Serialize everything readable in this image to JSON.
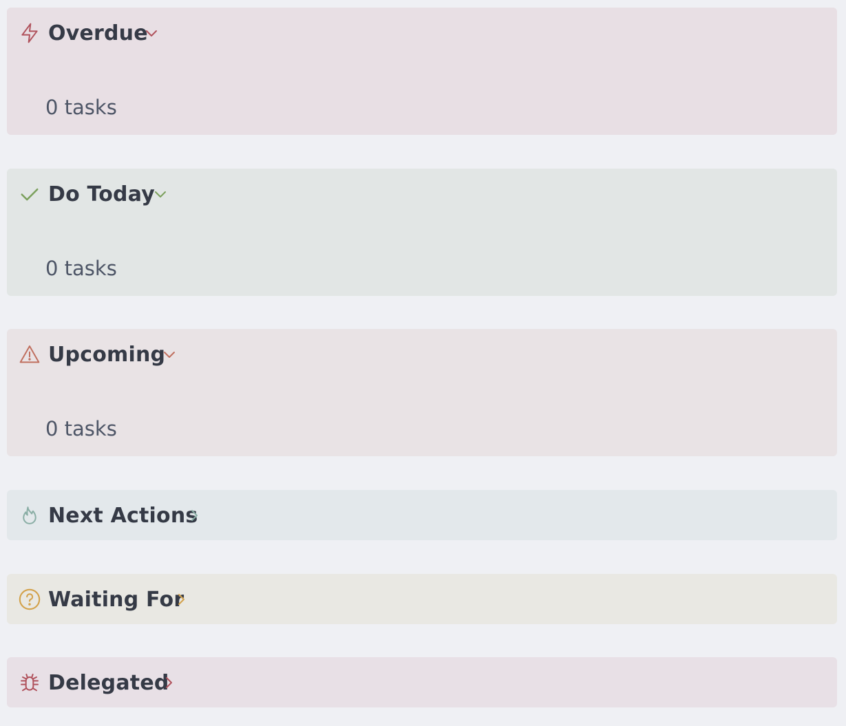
{
  "sections": [
    {
      "title": "Overdue",
      "icon": "lightning-icon",
      "expanded": true,
      "count_text": "0 tasks",
      "bg_color": "#e8dfe4",
      "accent_color": "#b0525c"
    },
    {
      "title": "Do Today",
      "icon": "check-icon",
      "expanded": true,
      "count_text": "0 tasks",
      "bg_color": "#e2e6e5",
      "accent_color": "#7ba05c"
    },
    {
      "title": "Upcoming",
      "icon": "warning-triangle-icon",
      "expanded": true,
      "count_text": "0 tasks",
      "bg_color": "#e9e3e5",
      "accent_color": "#c06f5f"
    },
    {
      "title": "Next Actions",
      "icon": "flame-icon",
      "expanded": false,
      "bg_color": "#e3e8eb",
      "accent_color": "#8aaea5"
    },
    {
      "title": "Waiting For",
      "icon": "question-circle-icon",
      "expanded": false,
      "bg_color": "#e9e8e3",
      "accent_color": "#d3a24c"
    },
    {
      "title": "Delegated",
      "icon": "bug-icon",
      "expanded": false,
      "bg_color": "#e8e0e6",
      "accent_color": "#b0525c"
    }
  ]
}
